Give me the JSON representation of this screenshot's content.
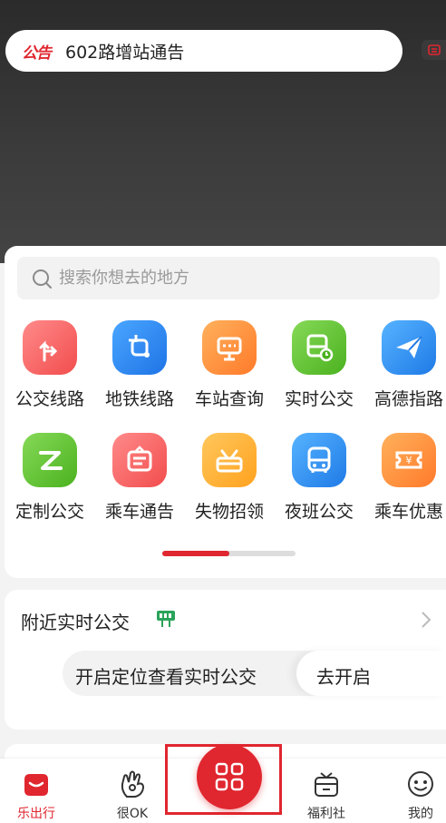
{
  "notice": {
    "tag": "公告",
    "text": "602路增站通告"
  },
  "search": {
    "placeholder": "搜索你想去的地方"
  },
  "services": [
    {
      "label": "公交线路",
      "icon": "route-arrow-icon",
      "color": "#f25a5a"
    },
    {
      "label": "地铁线路",
      "icon": "subway-path-icon",
      "color": "#2f8cf0"
    },
    {
      "label": "车站查询",
      "icon": "station-board-icon",
      "color": "#ff8a3d"
    },
    {
      "label": "实时公交",
      "icon": "realtime-bus-icon",
      "color": "#5cc134"
    },
    {
      "label": "高德指路",
      "icon": "paper-plane-icon",
      "color": "#2f8cf0"
    },
    {
      "label": "定制公交",
      "icon": "custom-bus-icon",
      "color": "#5cc134"
    },
    {
      "label": "乘车通告",
      "icon": "notice-board-icon",
      "color": "#f25a5a"
    },
    {
      "label": "失物招领",
      "icon": "lost-found-basket-icon",
      "color": "#ffb02e"
    },
    {
      "label": "夜班公交",
      "icon": "night-bus-icon",
      "color": "#2f8cf0"
    },
    {
      "label": "乘车优惠",
      "icon": "coupon-ticket-icon",
      "color": "#ff8a3d"
    }
  ],
  "carousel": {
    "progress": 0.5
  },
  "nearby": {
    "title": "附近实时公交",
    "locate_text": "开启定位查看实时公交",
    "locate_button": "去开启"
  },
  "tabbar": {
    "items": [
      {
        "label": "乐出行",
        "icon": "home-icon",
        "active": true
      },
      {
        "label": "很OK",
        "icon": "ok-hand-icon",
        "active": false
      },
      {
        "label": "",
        "icon": "scan-qr-icon",
        "active": false
      },
      {
        "label": "福利社",
        "icon": "welfare-box-icon",
        "active": false
      },
      {
        "label": "我的",
        "icon": "profile-face-icon",
        "active": false
      }
    ]
  },
  "colors": {
    "accent": "#e0262f",
    "panel": "#ffffff",
    "background": "#f3f3f3"
  }
}
